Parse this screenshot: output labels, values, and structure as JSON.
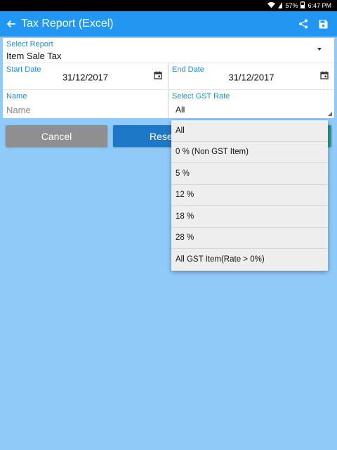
{
  "status_bar": {
    "battery": "57%",
    "time": "6:47 PM"
  },
  "app_bar": {
    "title": "Tax Report (Excel)"
  },
  "form": {
    "select_report": {
      "label": "Select Report",
      "value": "Item Sale Tax"
    },
    "start_date": {
      "label": "Start Date",
      "value": "31/12/2017"
    },
    "end_date": {
      "label": "End Date",
      "value": "31/12/2017"
    },
    "name": {
      "label": "Name",
      "placeholder": "Name",
      "value": ""
    },
    "gst_rate": {
      "label": "Select GST Rate",
      "value": "All"
    }
  },
  "buttons": {
    "cancel": "Cancel",
    "reset": "Rese"
  },
  "gst_dropdown": {
    "options": [
      "All",
      "0 % (Non GST Item)",
      "5 %",
      "12 %",
      "18 %",
      "28 %",
      "All GST Item(Rate > 0%)"
    ]
  },
  "colors": {
    "background": "#90CAF9",
    "app_bar": "#2196F3",
    "label": "#1E88E5",
    "cancel_button": "#8F8F8F",
    "reset_button": "#1E78C8",
    "green_button": "#1BA085"
  },
  "icons": {
    "back": "arrow-left-icon",
    "share": "share-icon",
    "save": "save-icon",
    "calendar": "calendar-icon",
    "dropdown": "caret-down-icon",
    "wifi": "wifi-icon",
    "battery": "battery-icon"
  }
}
